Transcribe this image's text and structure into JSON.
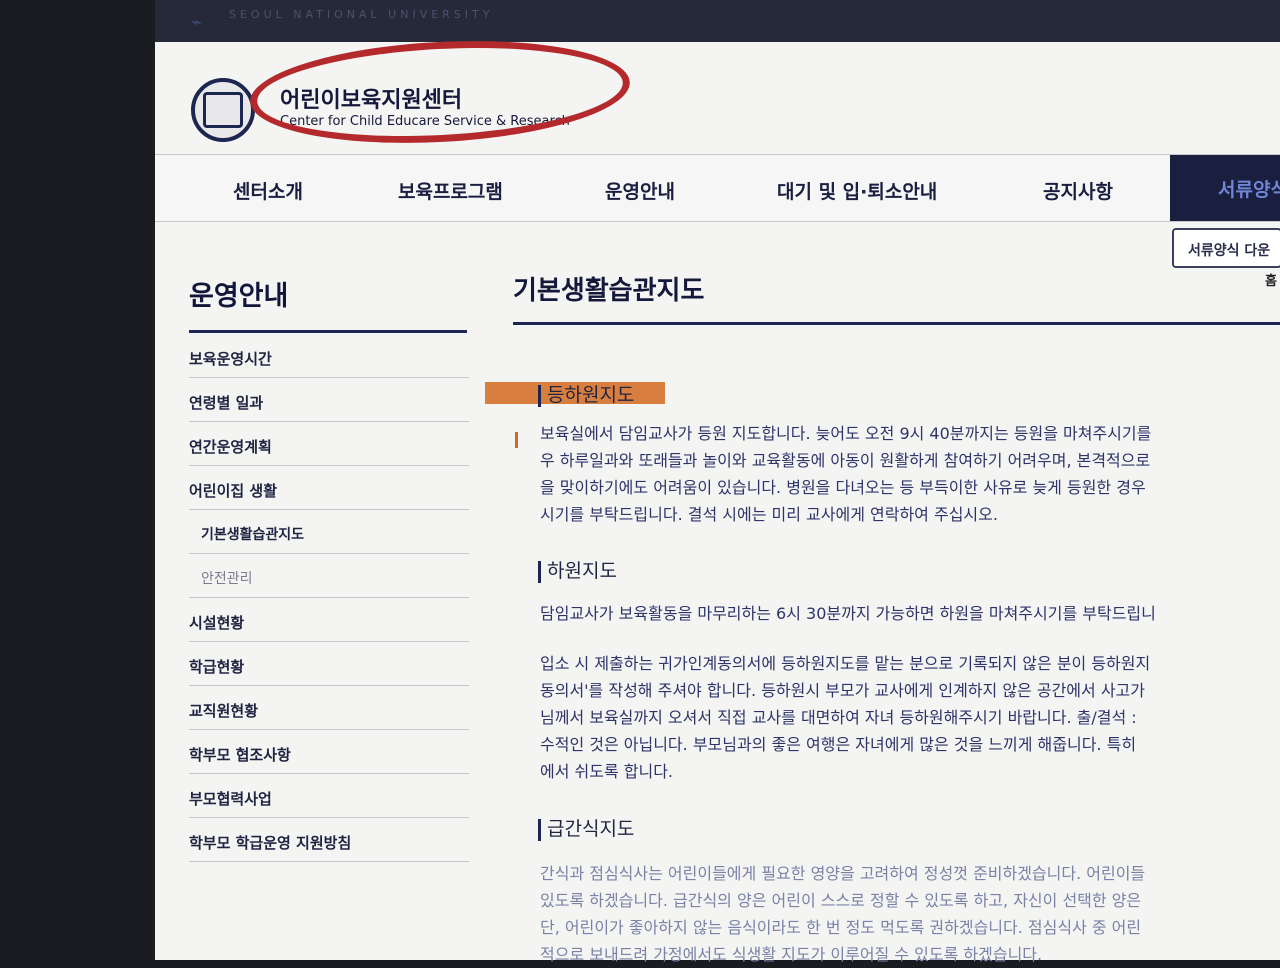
{
  "top_bar": {
    "university": "SEOUL NATIONAL UNIVERSITY"
  },
  "header": {
    "title_ko": "어린이보육지원센터",
    "title_en": "Center for Child Educare Service & Research"
  },
  "gnb": {
    "items": [
      {
        "label": "센터소개"
      },
      {
        "label": "보육프로그램"
      },
      {
        "label": "운영안내"
      },
      {
        "label": "대기 및 입·퇴소안내"
      },
      {
        "label": "공지사항"
      },
      {
        "label": "서류양식"
      }
    ],
    "dropdown_label": "서류양식 다운",
    "dropdown_sub": "홈"
  },
  "lnb": {
    "title": "운영안내",
    "items": [
      {
        "label": "보육운영시간"
      },
      {
        "label": "연령별 일과"
      },
      {
        "label": "연간운영계획"
      },
      {
        "label": "어린이집 생활"
      },
      {
        "label": "기본생활습관지도"
      },
      {
        "label": "안전관리"
      },
      {
        "label": "시설현황"
      },
      {
        "label": "학급현황"
      },
      {
        "label": "교직원현황"
      },
      {
        "label": "학부모 협조사항"
      },
      {
        "label": "부모협력사업"
      },
      {
        "label": "학부모 학급운영 지원방침"
      }
    ]
  },
  "content": {
    "page_title": "기본생활습관지도",
    "sections": [
      {
        "heading": "등하원지도",
        "lines": [
          "보육실에서 담임교사가 등원 지도합니다. 늦어도 오전 9시 40분까지는 등원을 마쳐주시기를",
          "우 하루일과와 또래들과 놀이와 교육활동에 아동이 원활하게 참여하기 어려우며, 본격적으로",
          "을 맞이하기에도 어려움이 있습니다. 병원을 다녀오는 등 부득이한 사유로 늦게 등원한 경우",
          "시기를 부탁드립니다. 결석 시에는 미리 교사에게 연락하여 주십시오."
        ]
      },
      {
        "heading": "하원지도",
        "lines": [
          "담임교사가 보육활동을 마무리하는 6시 30분까지 가능하면 하원을 마쳐주시기를 부탁드립니",
          "입소 시 제출하는 귀가인계동의서에 등하원지도를 맡는 분으로 기록되지 않은 분이 등하원지",
          "동의서'를 작성해 주셔야 합니다. 등하원시 부모가 교사에게 인계하지 않은 공간에서 사고가",
          "님께서 보육실까지 오셔서 직접 교사를 대면하여 자녀 등하원해주시기 바랍니다. 출/결석 :",
          "수적인 것은 아닙니다. 부모님과의 좋은 여행은 자녀에게 많은 것을 느끼게 해줍니다. 특히",
          "에서 쉬도록 합니다."
        ]
      },
      {
        "heading": "급간식지도",
        "lines": [
          "간식과 점심식사는 어린이들에게 필요한 영양을 고려하여 정성껏 준비하겠습니다. 어린이들",
          "있도록 하겠습니다. 급간식의 양은 어린이 스스로 정할 수 있도록 하고, 자신이 선택한 양은",
          "단, 어린이가 좋아하지 않는 음식이라도 한 번 정도 먹도록 권하겠습니다. 점심식사 중 어린",
          "적으로 보내드려 가정에서도 식생활 지도가 이루어질 수 있도록 하겠습니다."
        ]
      }
    ]
  },
  "colors": {
    "navy": "#1c2650",
    "marker_red": "#b42a2c",
    "highlight_orange": "#d2691e",
    "text_blue": "#2e3468"
  }
}
